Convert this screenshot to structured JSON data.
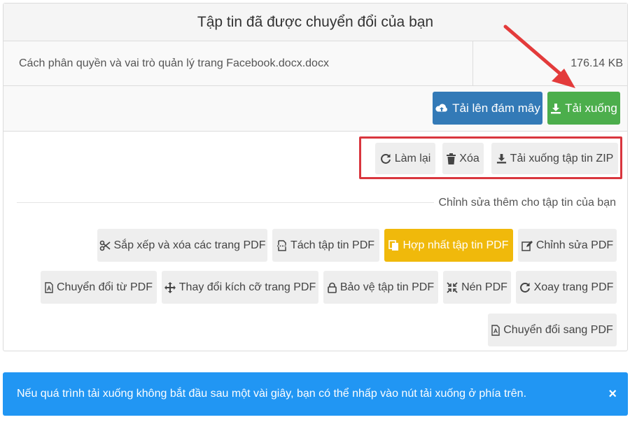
{
  "panel": {
    "title": "Tập tin đã được chuyển đổi của bạn",
    "file_name": "Cách phân quyền và vai trò quản lý trang Facebook.docx.docx",
    "file_size": "176.14 KB"
  },
  "actions": {
    "upload_cloud": "Tải lên đám mây",
    "download": "Tải xuống"
  },
  "secondary_actions": {
    "redo": "Làm lại",
    "delete": "Xóa",
    "download_zip": "Tải xuống tập tin ZIP"
  },
  "edit": {
    "label": "Chỉnh sửa thêm cho tập tin của bạn",
    "tools": {
      "sort_delete": "Sắp xếp và xóa các trang PDF",
      "split": "Tách tập tin PDF",
      "merge": "Hợp nhất tập tin PDF",
      "edit_pdf": "Chỉnh sửa PDF",
      "convert_from": "Chuyển đổi từ PDF",
      "resize": "Thay đổi kích cỡ trang PDF",
      "protect": "Bảo vệ tập tin PDF",
      "compress": "Nén PDF",
      "rotate": "Xoay trang PDF",
      "convert_to": "Chuyển đổi sang PDF"
    }
  },
  "alert": {
    "message": "Nếu quá trình tải xuống không bắt đầu sau một vài giây, bạn có thể nhấp vào nút tải xuống ở phía trên.",
    "close": "×"
  },
  "colors": {
    "primary_blue": "#337ab7",
    "success_green": "#4cae4c",
    "warning_yellow": "#f0b90b",
    "alert_blue": "#2196f3",
    "highlight_red": "#d9363e"
  }
}
